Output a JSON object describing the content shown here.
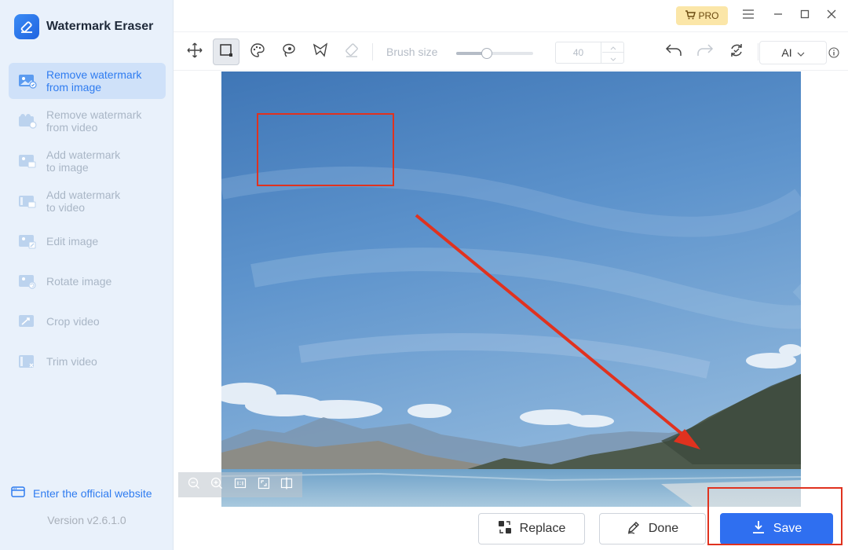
{
  "app": {
    "title": "Watermark Eraser",
    "version": "Version v2.6.1.0",
    "website_link": "Enter the official website",
    "pro_label": "PRO"
  },
  "sidebar": {
    "items": [
      {
        "label": "Remove watermark\nfrom image",
        "icon": "image-erase-icon",
        "active": true
      },
      {
        "label": "Remove watermark\nfrom video",
        "icon": "video-erase-icon",
        "active": false
      },
      {
        "label": "Add watermark\nto image",
        "icon": "image-add-watermark-icon",
        "active": false
      },
      {
        "label": "Add watermark\nto video",
        "icon": "video-add-watermark-icon",
        "active": false
      },
      {
        "label": "Edit image",
        "icon": "edit-image-icon",
        "active": false
      },
      {
        "label": "Rotate image",
        "icon": "rotate-image-icon",
        "active": false
      },
      {
        "label": "Crop video",
        "icon": "crop-video-icon",
        "active": false
      },
      {
        "label": "Trim video",
        "icon": "trim-video-icon",
        "active": false
      }
    ]
  },
  "toolbar": {
    "tools": [
      "move-icon",
      "rectangle-select-icon",
      "palette-icon",
      "lasso-icon",
      "polygon-lasso-icon",
      "eraser-icon"
    ],
    "active_tool": "rectangle-select-icon",
    "brush_label": "Brush size",
    "brush_value": "40",
    "brush_level": 0.4,
    "ai_label": "AI"
  },
  "actions": {
    "replace": "Replace",
    "done": "Done",
    "save": "Save"
  },
  "colors": {
    "accent": "#2f6ff0",
    "annotation": "#e0321f",
    "sidebar_bg": "#e9f1fb",
    "active_item_bg": "#cfe1f9"
  }
}
